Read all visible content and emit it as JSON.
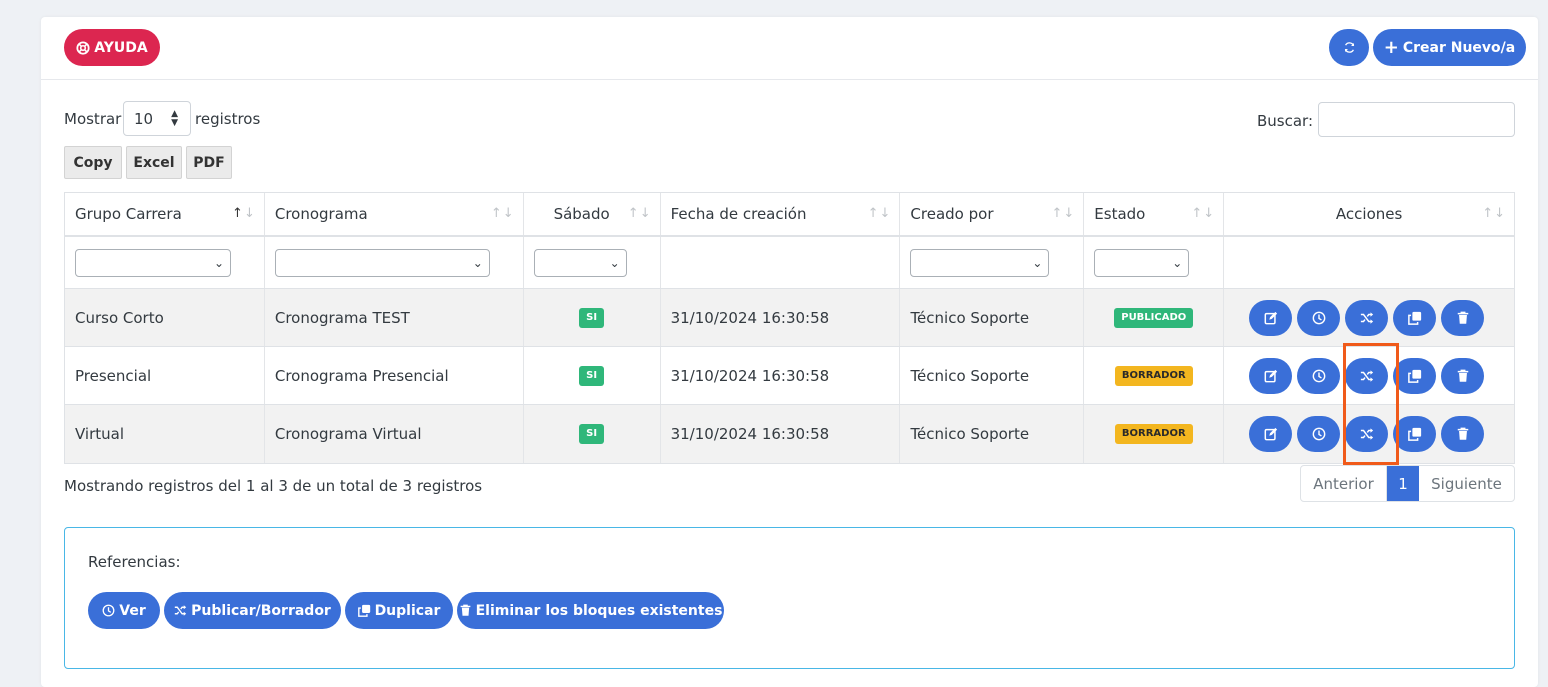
{
  "header": {
    "help_label": "AYUDA",
    "create_label": "Crear Nuevo/a"
  },
  "controls": {
    "show_label": "Mostrar",
    "page_length": "10",
    "records_label": "registros",
    "search_label": "Buscar:",
    "search_value": ""
  },
  "export": {
    "copy": "Copy",
    "excel": "Excel",
    "pdf": "PDF"
  },
  "table": {
    "headers": [
      "Grupo Carrera",
      "Cronograma",
      "Sábado",
      "Fecha de creación",
      "Creado por",
      "Estado",
      "Acciones"
    ],
    "rows": [
      {
        "grupo": "Curso Corto",
        "cronograma": "Cronograma TEST",
        "sabado": "SI",
        "fecha": "31/10/2024 16:30:58",
        "creado_por": "Técnico Soporte",
        "estado": "PUBLICADO"
      },
      {
        "grupo": "Presencial",
        "cronograma": "Cronograma Presencial",
        "sabado": "SI",
        "fecha": "31/10/2024 16:30:58",
        "creado_por": "Técnico Soporte",
        "estado": "BORRADOR"
      },
      {
        "grupo": "Virtual",
        "cronograma": "Cronograma Virtual",
        "sabado": "SI",
        "fecha": "31/10/2024 16:30:58",
        "creado_por": "Técnico Soporte",
        "estado": "BORRADOR"
      }
    ]
  },
  "footer": {
    "info": "Mostrando registros del 1 al 3 de un total de 3 registros",
    "prev": "Anterior",
    "page": "1",
    "next": "Siguiente"
  },
  "references": {
    "title": "Referencias:",
    "ver": "Ver",
    "publicar": "Publicar/Borrador",
    "duplicar": "Duplicar",
    "eliminar": "Eliminar los bloques existentes"
  },
  "colors": {
    "primary": "#3a6fd8",
    "danger": "#dc2650",
    "success": "#2fb77a",
    "warning": "#f3b61f",
    "highlight": "#f05a1a"
  }
}
